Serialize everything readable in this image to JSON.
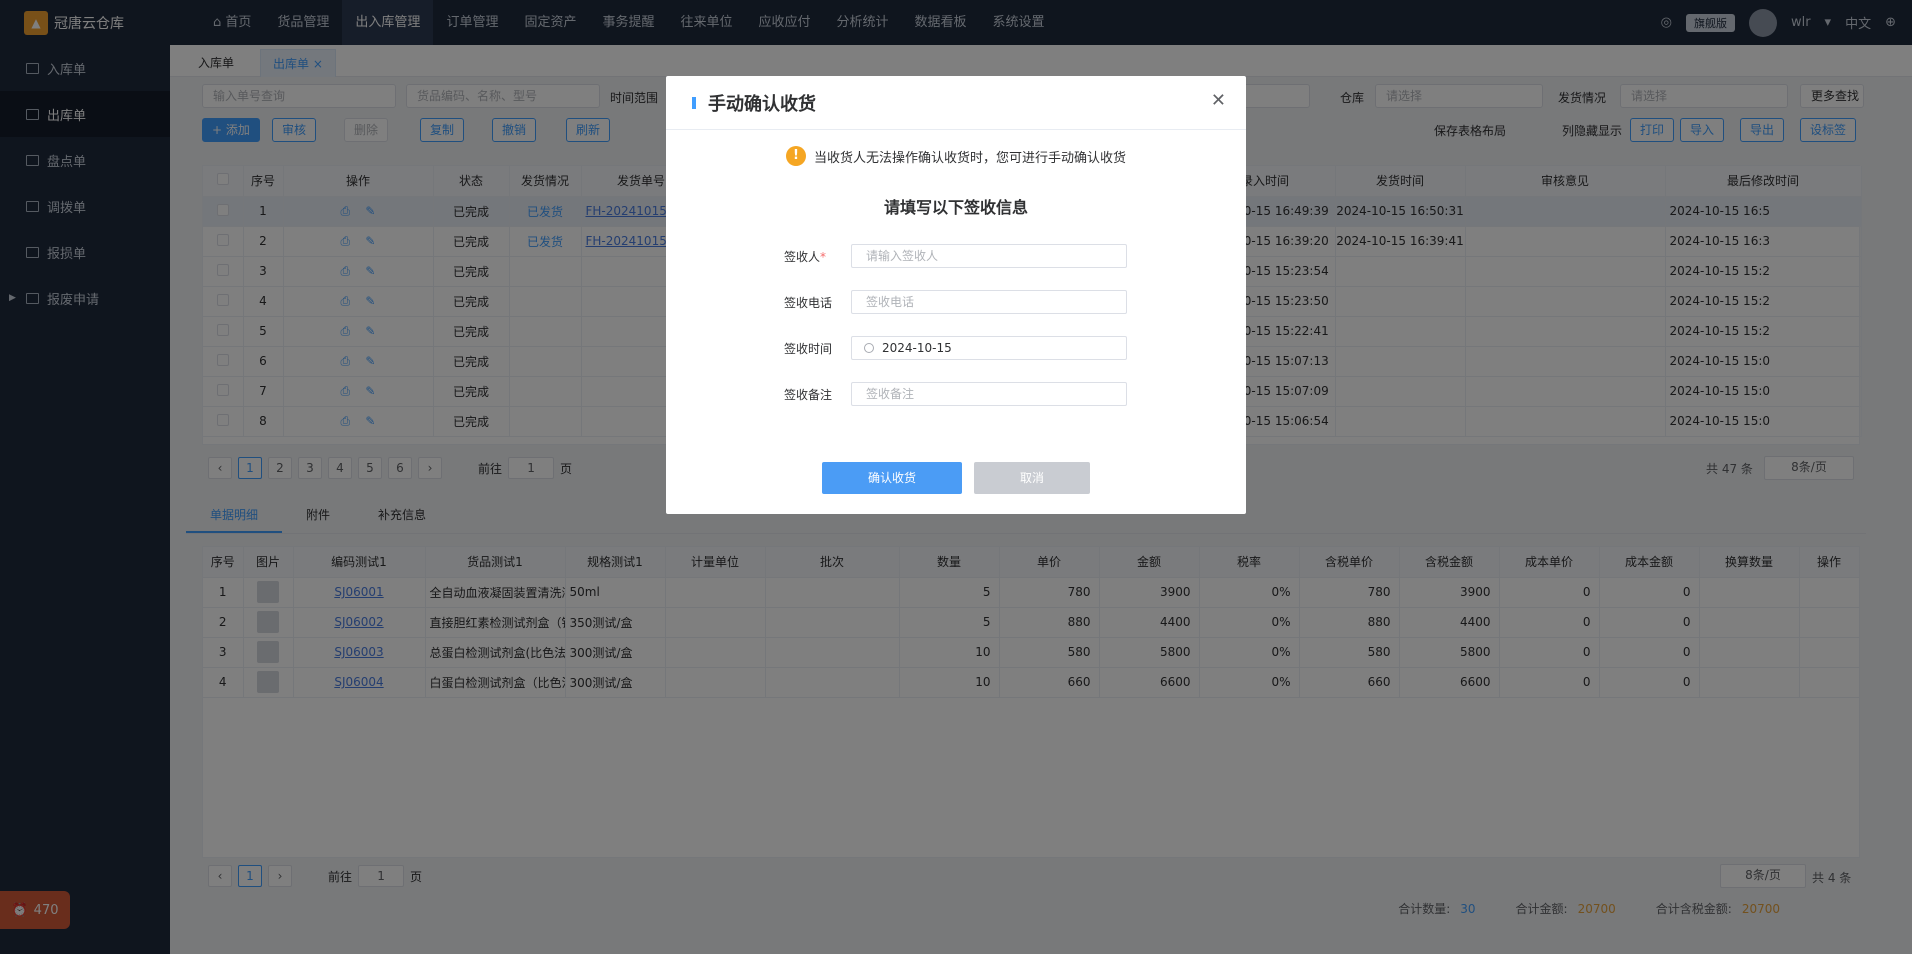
{
  "app": {
    "name": "冠唐云仓库",
    "badge_count": "470"
  },
  "sidebar": {
    "items": [
      {
        "label": "入库单",
        "active": false
      },
      {
        "label": "出库单",
        "active": true
      },
      {
        "label": "盘点单",
        "active": false
      },
      {
        "label": "调拨单",
        "active": false
      },
      {
        "label": "报损单",
        "active": false
      },
      {
        "label": "报废申请",
        "active": false
      }
    ]
  },
  "topnav": {
    "items": [
      "首页",
      "货品管理",
      "出入库管理",
      "订单管理",
      "固定资产",
      "事务提醒",
      "往来单位",
      "应收应付",
      "分析统计",
      "数据看板",
      "系统设置"
    ],
    "active": "出入库管理",
    "edition": "旗舰版",
    "user": "wlr",
    "lang": "中文"
  },
  "tabs": [
    {
      "label": "入库单"
    },
    {
      "label": "出库单 ×"
    }
  ],
  "filters": {
    "order_no": "输入单号查询",
    "goods": "货品编码、名称、型号",
    "time_range": "时间范围",
    "warehouse_label": "仓库",
    "warehouse_ph": "请选择",
    "ship_label": "发货情况",
    "ship_ph": "请选择",
    "more": "更多查找"
  },
  "toolbar": {
    "add": "+ 添加",
    "audit": "审核",
    "delete": "删除",
    "copy": "复制",
    "revoke": "撤销",
    "refresh": "刷新",
    "save_layout": "保存表格布局",
    "hide_cols": "列隐藏显示",
    "print": "打印",
    "import": "导入",
    "export": "导出",
    "tag": "设标签"
  },
  "grid1": {
    "headers": [
      "序号",
      "操作",
      "状态",
      "发货情况",
      "发货单号",
      "录入时间",
      "发货时间",
      "审核意见",
      "最后修改时间"
    ],
    "rows": [
      {
        "no": "1",
        "status": "已完成",
        "ship": "已发货",
        "ship_no": "FH-20241015-(",
        "entered": "2024-10-15 16:49:39",
        "shipped": "2024-10-15 16:50:31",
        "modified": "2024-10-15 16:5"
      },
      {
        "no": "2",
        "status": "已完成",
        "ship": "已发货",
        "ship_no": "FH-20241015-(",
        "entered": "2024-10-15 16:39:20",
        "shipped": "2024-10-15 16:39:41",
        "modified": "2024-10-15 16:3"
      },
      {
        "no": "3",
        "status": "已完成",
        "ship": "",
        "ship_no": "",
        "entered": "2024-10-15 15:23:54",
        "shipped": "",
        "modified": "2024-10-15 15:2"
      },
      {
        "no": "4",
        "status": "已完成",
        "ship": "",
        "ship_no": "",
        "entered": "2024-10-15 15:23:50",
        "shipped": "",
        "modified": "2024-10-15 15:2"
      },
      {
        "no": "5",
        "status": "已完成",
        "ship": "",
        "ship_no": "",
        "entered": "2024-10-15 15:22:41",
        "shipped": "",
        "modified": "2024-10-15 15:2"
      },
      {
        "no": "6",
        "status": "已完成",
        "ship": "",
        "ship_no": "",
        "entered": "2024-10-15 15:07:13",
        "shipped": "",
        "modified": "2024-10-15 15:0"
      },
      {
        "no": "7",
        "status": "已完成",
        "ship": "",
        "ship_no": "",
        "entered": "2024-10-15 15:07:09",
        "shipped": "",
        "modified": "2024-10-15 15:0"
      },
      {
        "no": "8",
        "status": "已完成",
        "ship": "",
        "ship_no": "",
        "entered": "2024-10-15 15:06:54",
        "shipped": "",
        "modified": "2024-10-15 15:0"
      }
    ],
    "pages": [
      "1",
      "2",
      "3",
      "4",
      "5",
      "6"
    ],
    "goto": "前往",
    "goto_val": "1",
    "page_unit": "页",
    "total": "共 47 条",
    "page_size": "8条/页"
  },
  "subtabs": [
    "单据明细",
    "附件",
    "补充信息"
  ],
  "grid2": {
    "headers": [
      "序号",
      "图片",
      "编码测试1",
      "货品测试1",
      "规格测试1",
      "计量单位",
      "批次",
      "数量",
      "单价",
      "金额",
      "税率",
      "含税单价",
      "含税金额",
      "成本单价",
      "成本金额",
      "换算数量",
      "操作"
    ],
    "rows": [
      {
        "no": "1",
        "code": "SJ06001",
        "name": "全自动血液凝固装置清洗液",
        "spec": "50ml",
        "qty": "5",
        "price": "780",
        "amount": "3900",
        "tax": "0%",
        "tprice": "780",
        "tamount": "3900",
        "cprice": "0",
        "camount": "0"
      },
      {
        "no": "2",
        "code": "SJ06002",
        "name": "直接胆红素检测试剂盒（钒",
        "spec": "350测试/盒",
        "qty": "5",
        "price": "880",
        "amount": "4400",
        "tax": "0%",
        "tprice": "880",
        "tamount": "4400",
        "cprice": "0",
        "camount": "0"
      },
      {
        "no": "3",
        "code": "SJ06003",
        "name": "总蛋白检测试剂盒(比色法",
        "spec": "300测试/盒",
        "qty": "10",
        "price": "580",
        "amount": "5800",
        "tax": "0%",
        "tprice": "580",
        "tamount": "5800",
        "cprice": "0",
        "camount": "0"
      },
      {
        "no": "4",
        "code": "SJ06004",
        "name": "白蛋白检测试剂盒（比色法",
        "spec": "300测试/盒",
        "qty": "10",
        "price": "660",
        "amount": "6600",
        "tax": "0%",
        "tprice": "660",
        "tamount": "6600",
        "cprice": "0",
        "camount": "0"
      }
    ],
    "page": "1",
    "goto": "前往",
    "goto_val": "1",
    "page_unit": "页",
    "page_size": "8条/页",
    "total": "共 4 条"
  },
  "summary": {
    "qty_label": "合计数量:",
    "qty": "30",
    "amount_label": "合计金额:",
    "amount": "20700",
    "tax_amount_label": "合计含税金额:",
    "tax_amount": "20700"
  },
  "dialog": {
    "title": "手动确认收货",
    "warning": "当收货人无法操作确认收货时，您可进行手动确认收货",
    "subtitle": "请填写以下签收信息",
    "fields": [
      {
        "label": "签收人",
        "placeholder": "请输入签收人",
        "required": true
      },
      {
        "label": "签收电话",
        "placeholder": "签收电话"
      },
      {
        "label": "签收时间",
        "value": "2024-10-15"
      },
      {
        "label": "签收备注",
        "placeholder": "签收备注"
      }
    ],
    "confirm": "确认收货",
    "cancel": "取消"
  },
  "colors": {
    "primary": "#409eff",
    "sidebar": "#1f2a3d",
    "warning": "#f5a623",
    "accent_orange": "#e6a23c"
  }
}
